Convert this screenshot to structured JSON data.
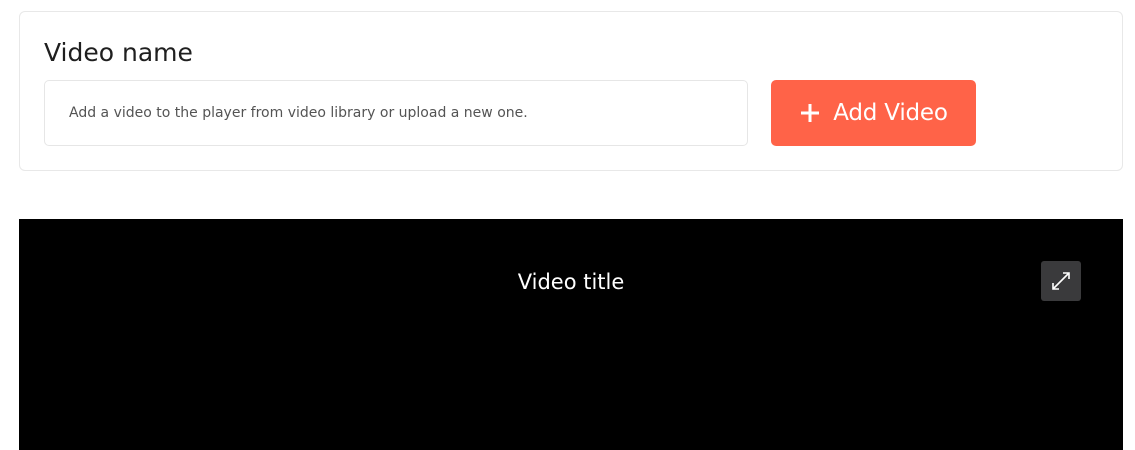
{
  "video_card": {
    "title": "Video name",
    "field_text": "Add a video to the player from video library or upload a new one.",
    "add_button_label": "Add Video",
    "add_button_icon": "plus-icon",
    "accent_color": "#ff6348"
  },
  "player": {
    "title": "Video title",
    "expand_icon": "expand-icon",
    "background_color": "#000000"
  }
}
